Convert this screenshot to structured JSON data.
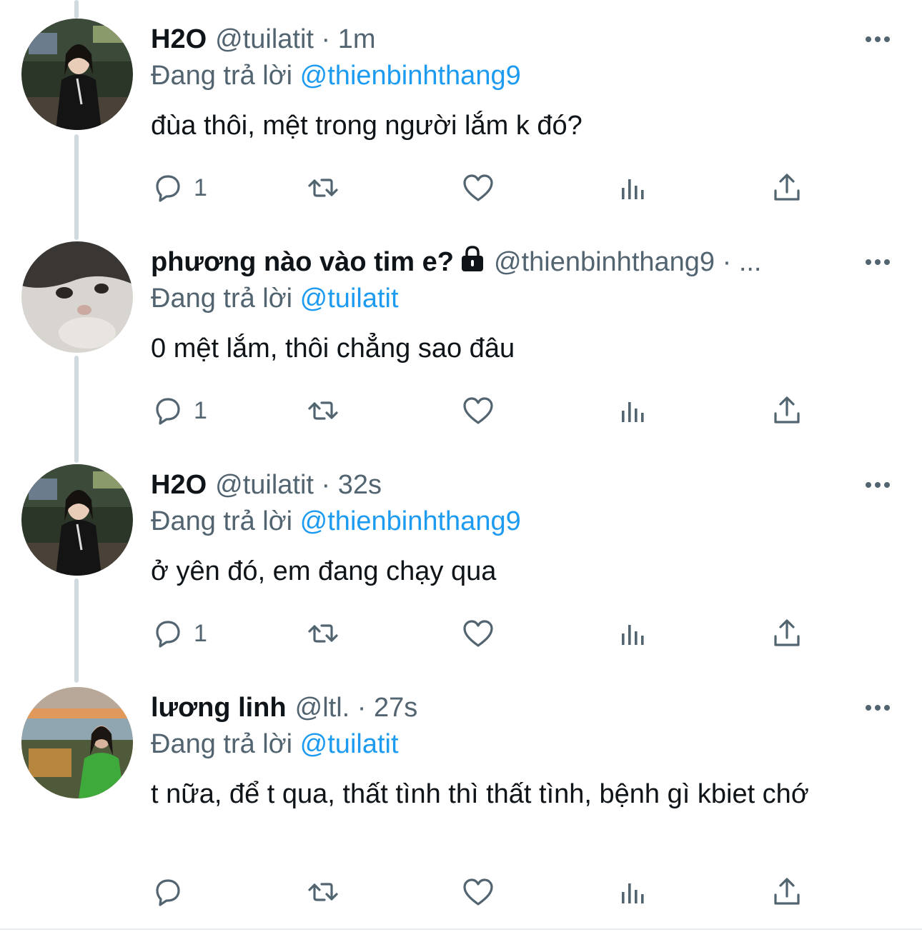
{
  "tweets": [
    {
      "name": "H2O",
      "handle": "@tuilatit",
      "time": "1m",
      "meta": "@tuilatit · 1m",
      "reply_prefix": "Đang trả lời",
      "reply_to": "@thienbinhthang9",
      "text": "đùa thôi, mệt trong người lắm k đó?",
      "reply_count": "1",
      "avatar": "portrait-girl-street-night"
    },
    {
      "name": "phương nào vào tim e?",
      "handle": "@thienbinhthang9",
      "meta": "@thienbinhthang9 · ...",
      "locked": true,
      "reply_prefix": "Đang trả lời",
      "reply_to": "@tuilatit",
      "text": "0 mệt lắm, thôi chẳng sao đâu",
      "reply_count": "1",
      "avatar": "cat-face-closeup"
    },
    {
      "name": "H2O",
      "handle": "@tuilatit",
      "time": "32s",
      "meta": "@tuilatit · 32s",
      "reply_prefix": "Đang trả lời",
      "reply_to": "@thienbinhthang9",
      "text": "ở yên đó, em đang chạy qua",
      "reply_count": "1",
      "avatar": "portrait-girl-street-night"
    },
    {
      "name": "lương linh",
      "handle": "@ltl.",
      "time": "27s",
      "meta": "@ltl. · 27s",
      "reply_prefix": "Đang trả lời",
      "reply_to": "@tuilatit",
      "text": "t nữa, để t qua, thất tình thì thất tình, bệnh gì kbiet chớ",
      "reply_count": "",
      "avatar": "portrait-girl-beach-sunset"
    }
  ],
  "icons": {
    "reply": "reply-bubble-icon",
    "retweet": "retweet-icon",
    "like": "heart-icon",
    "views": "views-bar-chart-icon",
    "share": "share-upload-icon",
    "more": "more-dots-icon",
    "lock": "lock-icon"
  },
  "colors": {
    "text": "#0f1419",
    "secondary": "#536471",
    "link": "#1d9bf0",
    "thread_line": "#cfd9de"
  }
}
